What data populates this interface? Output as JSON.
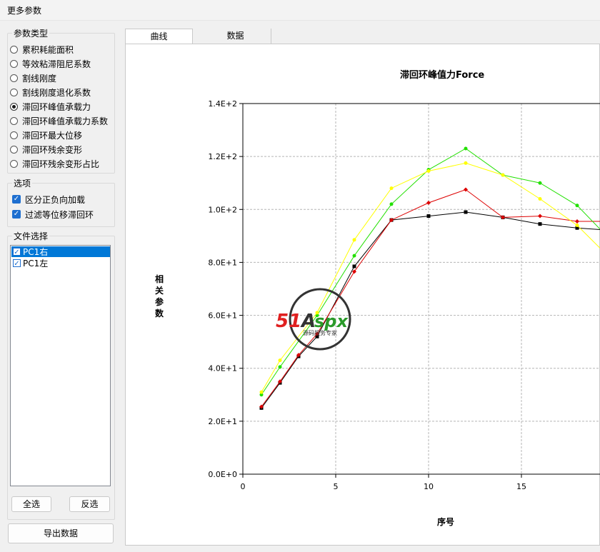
{
  "window": {
    "title": "更多参数"
  },
  "param_type": {
    "title": "参数类型",
    "options": [
      {
        "label": "累积耗能面积",
        "selected": false
      },
      {
        "label": "等效粘滞阻尼系数",
        "selected": false
      },
      {
        "label": "割线刚度",
        "selected": false
      },
      {
        "label": "割线刚度退化系数",
        "selected": false
      },
      {
        "label": "滞回环峰值承载力",
        "selected": true
      },
      {
        "label": "滞回环峰值承载力系数",
        "selected": false
      },
      {
        "label": "滞回环最大位移",
        "selected": false
      },
      {
        "label": "滞回环残余变形",
        "selected": false
      },
      {
        "label": "滞回环残余变形占比",
        "selected": false
      }
    ]
  },
  "options": {
    "title": "选项",
    "items": [
      {
        "label": "区分正负向加载",
        "checked": true
      },
      {
        "label": "过滤等位移滞回环",
        "checked": true
      }
    ]
  },
  "files": {
    "title": "文件选择",
    "items": [
      {
        "label": "PC1右",
        "checked": true,
        "selected": true
      },
      {
        "label": "PC1左",
        "checked": true,
        "selected": false
      }
    ],
    "select_all": "全选",
    "invert": "反选"
  },
  "export_label": "导出数据",
  "tabs": [
    {
      "label": "曲线",
      "active": true
    },
    {
      "label": "数据",
      "active": false
    }
  ],
  "watermark": {
    "brand": "51Aspx",
    "tagline": "源码服务专家"
  },
  "chart_data": {
    "type": "line",
    "title": "滞回环峰值力Force",
    "xlabel": "序号",
    "ylabel": "相关参数",
    "xlim": [
      0,
      19.5
    ],
    "ylim": [
      0,
      140
    ],
    "xticks": [
      0,
      5,
      10,
      15
    ],
    "yticks": [
      {
        "v": 0,
        "label": "0.0E+0"
      },
      {
        "v": 20,
        "label": "2.0E+1"
      },
      {
        "v": 40,
        "label": "4.0E+1"
      },
      {
        "v": 60,
        "label": "6.0E+1"
      },
      {
        "v": 80,
        "label": "8.0E+1"
      },
      {
        "v": 100,
        "label": "1.0E+2"
      },
      {
        "v": 120,
        "label": "1.2E+2"
      },
      {
        "v": 140,
        "label": "1.4E+2"
      }
    ],
    "grid": true,
    "series": [
      {
        "color": "#000000",
        "marker": "square",
        "points": [
          [
            1,
            25
          ],
          [
            2,
            34.5
          ],
          [
            3,
            44.5
          ],
          [
            4,
            52
          ],
          [
            6,
            78.5
          ],
          [
            8,
            96
          ],
          [
            10,
            97.5
          ],
          [
            12,
            99
          ],
          [
            14,
            97
          ],
          [
            16,
            94.5
          ],
          [
            18,
            93
          ],
          [
            20,
            92
          ]
        ]
      },
      {
        "color": "#dd0000",
        "marker": "diamond",
        "points": [
          [
            1,
            25.5
          ],
          [
            2,
            35
          ],
          [
            3,
            45
          ],
          [
            4,
            53
          ],
          [
            6,
            76.5
          ],
          [
            8,
            96
          ],
          [
            10,
            102.5
          ],
          [
            12,
            107.5
          ],
          [
            14,
            97
          ],
          [
            16,
            97.5
          ],
          [
            18,
            95.5
          ],
          [
            20,
            95.5
          ]
        ]
      },
      {
        "color": "#22e000",
        "marker": "circle",
        "points": [
          [
            1,
            30
          ],
          [
            2,
            40.5
          ],
          [
            4,
            60
          ],
          [
            6,
            82.5
          ],
          [
            8,
            102
          ],
          [
            10,
            115
          ],
          [
            12,
            123
          ],
          [
            14,
            113
          ],
          [
            16,
            110
          ],
          [
            18,
            101.5
          ],
          [
            20,
            87
          ]
        ]
      },
      {
        "color": "#ffff00",
        "marker": "circle",
        "points": [
          [
            1,
            31
          ],
          [
            2,
            43
          ],
          [
            4,
            61
          ],
          [
            6,
            88.5
          ],
          [
            8,
            108
          ],
          [
            10,
            114.5
          ],
          [
            12,
            117.5
          ],
          [
            14,
            113
          ],
          [
            16,
            104
          ],
          [
            18,
            94
          ],
          [
            20,
            80
          ]
        ]
      }
    ]
  }
}
